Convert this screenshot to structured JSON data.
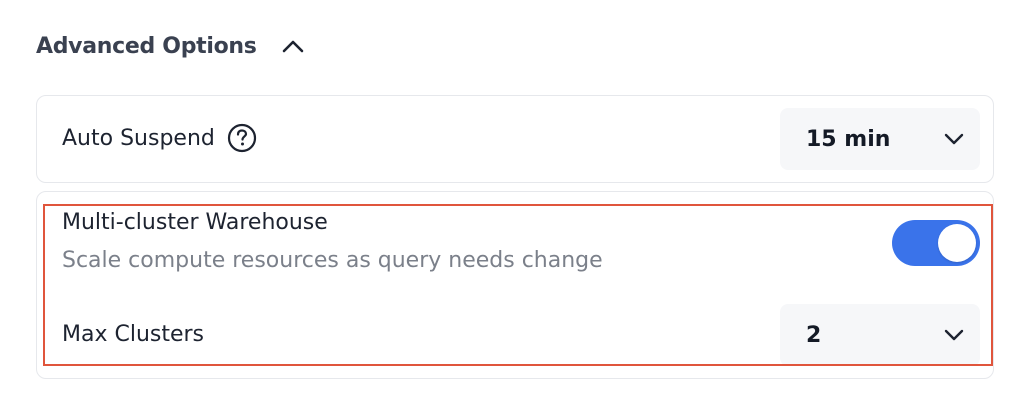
{
  "section": {
    "title": "Advanced Options"
  },
  "auto_suspend": {
    "label": "Auto Suspend",
    "value": "15 min"
  },
  "multi_cluster": {
    "title": "Multi-cluster Warehouse",
    "description": "Scale compute resources as query needs change",
    "enabled": true,
    "max_clusters_label": "Max Clusters",
    "max_clusters_value": "2"
  },
  "colors": {
    "accent": "#3a73ea",
    "highlight": "#e0553c"
  }
}
